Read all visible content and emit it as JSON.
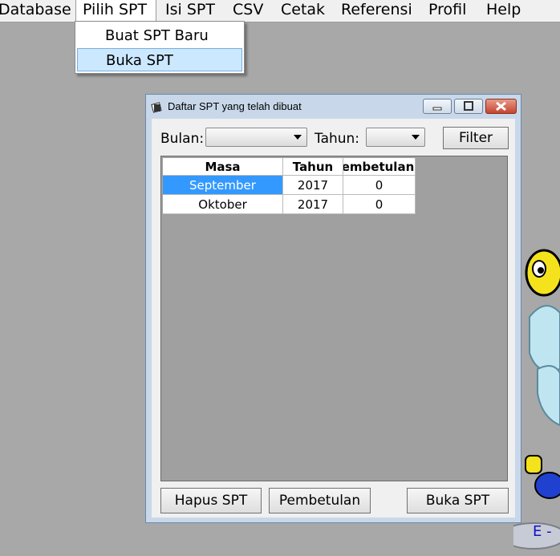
{
  "menubar": {
    "items": [
      "Database",
      "Pilih SPT",
      "Isi SPT",
      "CSV",
      "Cetak",
      "Referensi",
      "Profil",
      "Help"
    ]
  },
  "dropdown": {
    "items": [
      "Buat SPT Baru",
      "Buka SPT"
    ],
    "selected_index": 1
  },
  "background": {
    "partial_text": "E -"
  },
  "window": {
    "title": "Daftar SPT yang telah dibuat",
    "filter": {
      "bulan_label": "Bulan:",
      "bulan_value": "",
      "tahun_label": "Tahun:",
      "tahun_value": "",
      "filter_button": "Filter"
    },
    "table": {
      "columns": [
        "Masa",
        "Tahun",
        "Pembetulan"
      ],
      "rows": [
        [
          "September",
          "2017",
          "0"
        ],
        [
          "Oktober",
          "2017",
          "0"
        ]
      ],
      "selected_row": 0
    },
    "buttons": {
      "hapus": "Hapus SPT",
      "pembetulan": "Pembetulan",
      "buka": "Buka SPT"
    }
  },
  "colors": {
    "selection": "#3399ff",
    "menu_highlight": "#cce8ff",
    "background": "#a8a8a8"
  }
}
